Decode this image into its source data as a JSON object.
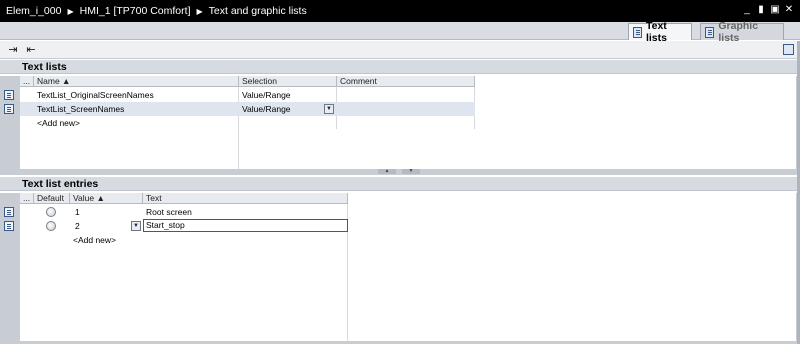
{
  "titlebar": {
    "crumbs": [
      "Elem_i_000",
      "HMI_1 [TP700 Comfort]",
      "Text and graphic lists"
    ],
    "controls": [
      "_",
      "▮",
      "▣",
      "✕"
    ]
  },
  "tabs": [
    {
      "label": "Text lists",
      "active": true
    },
    {
      "label": "Graphic lists",
      "active": false
    }
  ],
  "toolbar": {
    "left_icons": [
      "add-row-icon",
      "remove-row-icon"
    ],
    "right_icon": "layout-icon"
  },
  "text_lists": {
    "title": "Text lists",
    "columns": {
      "dots": "...",
      "name": "Name ▲",
      "selection": "Selection",
      "comment": "Comment"
    },
    "rows": [
      {
        "name": "TextList_OriginalScreenNames",
        "selection": "Value/Range",
        "comment": ""
      },
      {
        "name": "TextList_ScreenNames",
        "selection": "Value/Range",
        "comment": ""
      }
    ],
    "add_new": "<Add new>"
  },
  "entries": {
    "title": "Text list entries",
    "columns": {
      "dots": "...",
      "default": "Default",
      "value": "Value ▲",
      "text": "Text"
    },
    "rows": [
      {
        "value": "1",
        "text": "Root screen"
      },
      {
        "value": "2",
        "text": "Start_stop"
      }
    ],
    "add_new": "<Add new>"
  },
  "colors": {
    "titlebar_bg": "#000000",
    "section_header_bg": "#d6dbe2",
    "selected_row_bg": "#dfe5ee",
    "edit_border": "#2f5aa8"
  }
}
